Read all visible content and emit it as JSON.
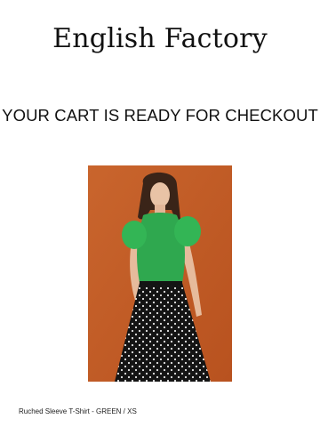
{
  "brand": {
    "logo_text": "English Factory"
  },
  "cart": {
    "headline": "YOUR CART IS READY FOR CHECKOUT"
  },
  "product": {
    "image_icon": "product-photo-model-green-top-polka-dot-skirt",
    "title": "Ruched Sleeve T-Shirt - GREEN / XS"
  },
  "colors": {
    "background": "#ffffff",
    "text": "#111111",
    "photo_backdrop": "#c05a26",
    "top_green": "#2fa84f",
    "skirt_black": "#141414"
  }
}
